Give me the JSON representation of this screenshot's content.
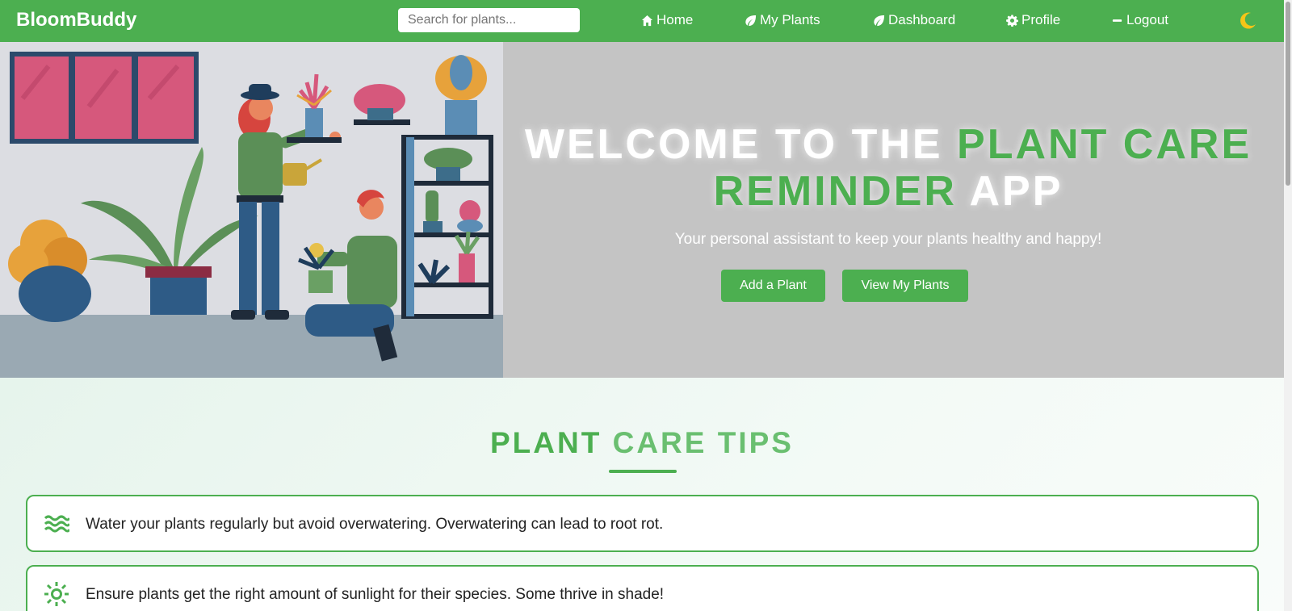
{
  "navbar": {
    "brand": "BloomBuddy",
    "search_placeholder": "Search for plants...",
    "links": [
      {
        "label": "Home",
        "icon": "home-icon"
      },
      {
        "label": "My Plants",
        "icon": "leaf-icon"
      },
      {
        "label": "Dashboard",
        "icon": "leaf-icon"
      },
      {
        "label": "Profile",
        "icon": "gear-icon"
      },
      {
        "label": "Logout",
        "icon": "minus-icon"
      }
    ],
    "theme_toggle_icon": "moon-icon"
  },
  "hero": {
    "title_part1": "WELCOME TO THE ",
    "title_highlight": "PLANT CARE REMINDER",
    "title_part2": " APP",
    "subtitle": "Your personal assistant to keep your plants healthy and happy!",
    "add_button": "Add a Plant",
    "view_button": "View My Plants"
  },
  "tips": {
    "title_word1": "PLANT",
    "title_word2": "CARE",
    "title_word3": "TIPS",
    "items": [
      {
        "icon": "water-waves-icon",
        "text": "Water your plants regularly but avoid overwatering. Overwatering can lead to root rot."
      },
      {
        "icon": "sun-icon",
        "text": "Ensure plants get the right amount of sunlight for their species. Some thrive in shade!"
      }
    ]
  },
  "colors": {
    "primary": "#4caf50",
    "hero_bg": "#c4c4c4",
    "tips_bg": "#eef6f1"
  }
}
